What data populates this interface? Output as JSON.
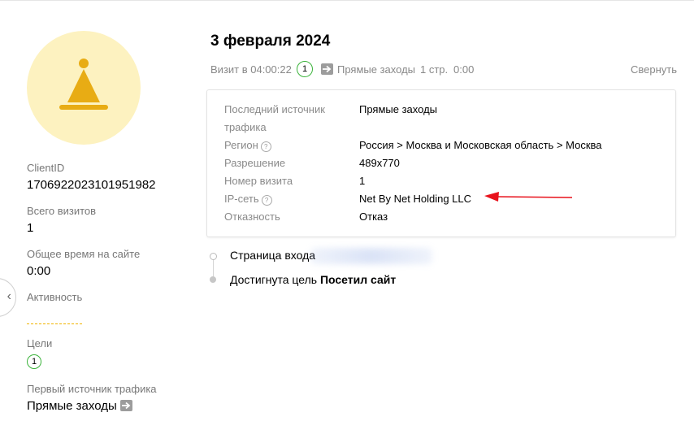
{
  "sidebar": {
    "client_id_label": "ClientID",
    "client_id_value": "1706922023101951982",
    "total_visits_label": "Всего визитов",
    "total_visits_value": "1",
    "total_time_label": "Общее время на сайте",
    "total_time_value": "0:00",
    "activity_label": "Активность",
    "goals_label": "Цели",
    "goals_count": "1",
    "first_source_label": "Первый источник трафика",
    "first_source_value": "Прямые заходы",
    "avatar_icon": "bell-icon",
    "accent_color": "#e8ac14"
  },
  "visit": {
    "date_title": "3 февраля 2024",
    "visit_time": "Визит в 04:00:22",
    "goals_badge": "1",
    "source": "Прямые заходы",
    "pages": "1 стр.",
    "duration": "0:00",
    "collapse_label": "Свернуть"
  },
  "details": [
    {
      "label": "Последний источник",
      "label2": "трафика",
      "value": "Прямые заходы"
    },
    {
      "label": "Регион",
      "value": "Россия > Москва и Московская область > Москва",
      "help": "?"
    },
    {
      "label": "Разрешение",
      "value": "489x770"
    },
    {
      "label": "Номер визита",
      "value": "1"
    },
    {
      "label": "IP-сеть",
      "value": "Net By Net Holding LLC",
      "help": "?"
    },
    {
      "label": "Отказность",
      "value": "Отказ"
    }
  ],
  "timeline": {
    "entry_page_label": "Страница входа",
    "goal_prefix": "Достигнута цель",
    "goal_name": "Посетил сайт"
  },
  "colors": {
    "goal_badge_border": "#3bb33b",
    "annotation_arrow": "#e8121c"
  }
}
